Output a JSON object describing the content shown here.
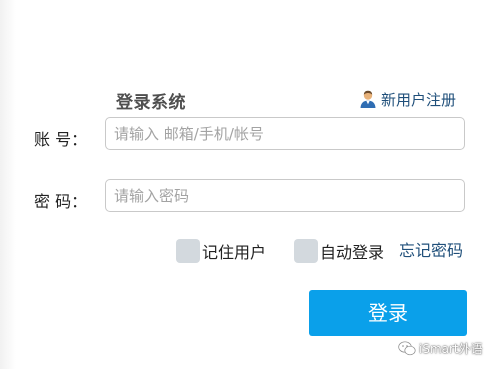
{
  "login_form": {
    "title": "登录系统",
    "register_link": "新用户注册",
    "account_label": "账 号：",
    "account_placeholder": "请输入 邮箱/手机/帐号",
    "password_label": "密 码：",
    "password_placeholder": "请输入密码",
    "remember_user_label": "记住用户",
    "auto_login_label": "自动登录",
    "forgot_password_link": "忘记密码",
    "login_button": "登录"
  },
  "watermark": {
    "text": "iSmart外语",
    "icon": "wechat-icon"
  },
  "colors": {
    "button_bg": "#0aa0ea",
    "link": "#1f4f7a",
    "checkbox_bg": "#d3d9de",
    "input_border": "#c9c9c9"
  },
  "icons": {
    "register": "user-icon",
    "watermark": "wechat-icon"
  }
}
